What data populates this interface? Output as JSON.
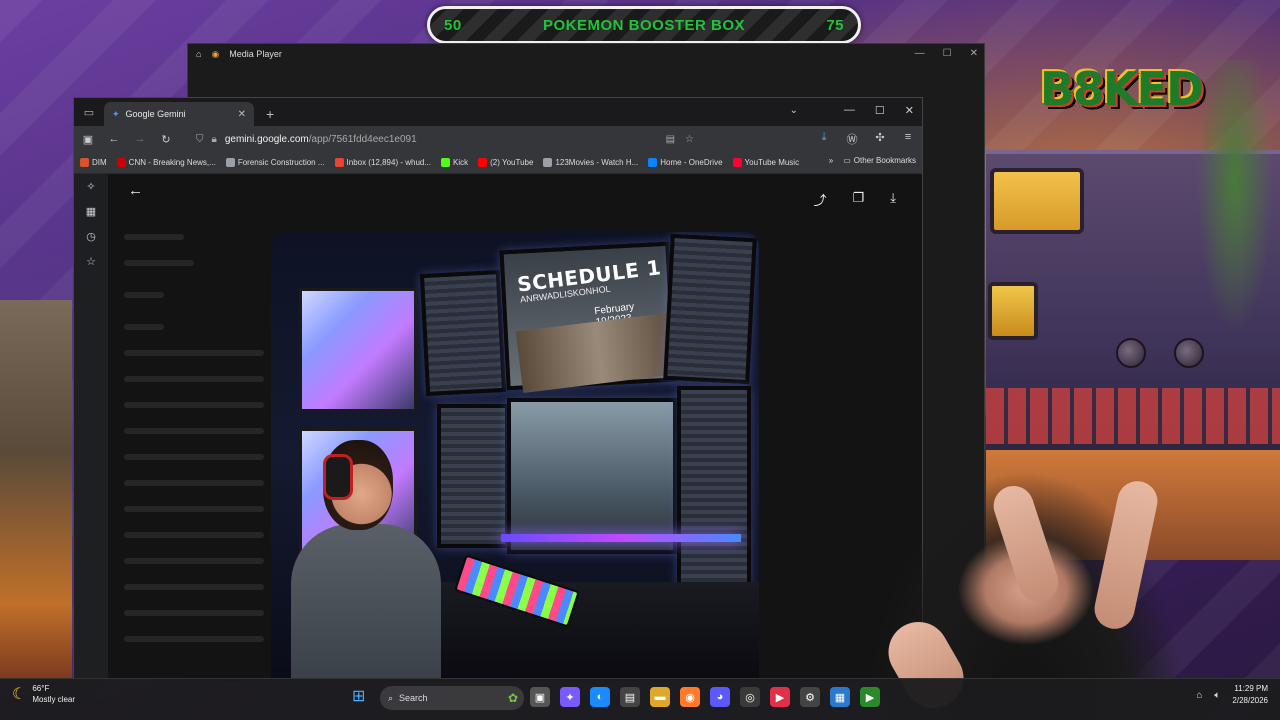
{
  "banner": {
    "left_value": "50",
    "title": "POKEMON BOOSTER BOX",
    "right_value": "75"
  },
  "logo": {
    "text": "B8KED"
  },
  "media_player": {
    "title": "Media Player"
  },
  "browser": {
    "tab_title": "Google Gemini",
    "address": {
      "host": "gemini.google.com",
      "path": "/app/7561fdd4eec1e091"
    },
    "bookmarks": [
      {
        "label": "DIM",
        "color": "#d9542b"
      },
      {
        "label": "CNN - Breaking News,...",
        "color": "#cc0000"
      },
      {
        "label": "Forensic Construction ...",
        "color": "#9aa0a6"
      },
      {
        "label": "Inbox (12,894) - whud...",
        "color": "#ea4335"
      },
      {
        "label": "Kick",
        "color": "#53fc18"
      },
      {
        "label": "(2) YouTube",
        "color": "#ff0000"
      },
      {
        "label": "123Movies - Watch H...",
        "color": "#9aa0a6"
      },
      {
        "label": "Home - OneDrive",
        "color": "#0a84ff"
      },
      {
        "label": "YouTube Music",
        "color": "#ff0033"
      }
    ],
    "other_bookmarks": "Other Bookmarks"
  },
  "generated_image": {
    "schedule_title": "SCHEDULE 1",
    "schedule_subtitle": "ANRWADLISKONHOL",
    "schedule_date": "February 19/2023"
  },
  "taskbar": {
    "weather_temp": "66°F",
    "weather_desc": "Mostly clear",
    "search_label": "Search",
    "time": "11:29 PM",
    "date": "2/28/2026"
  },
  "colors": {
    "accent_green": "#22c23a",
    "brand_red": "#d23a2a"
  }
}
